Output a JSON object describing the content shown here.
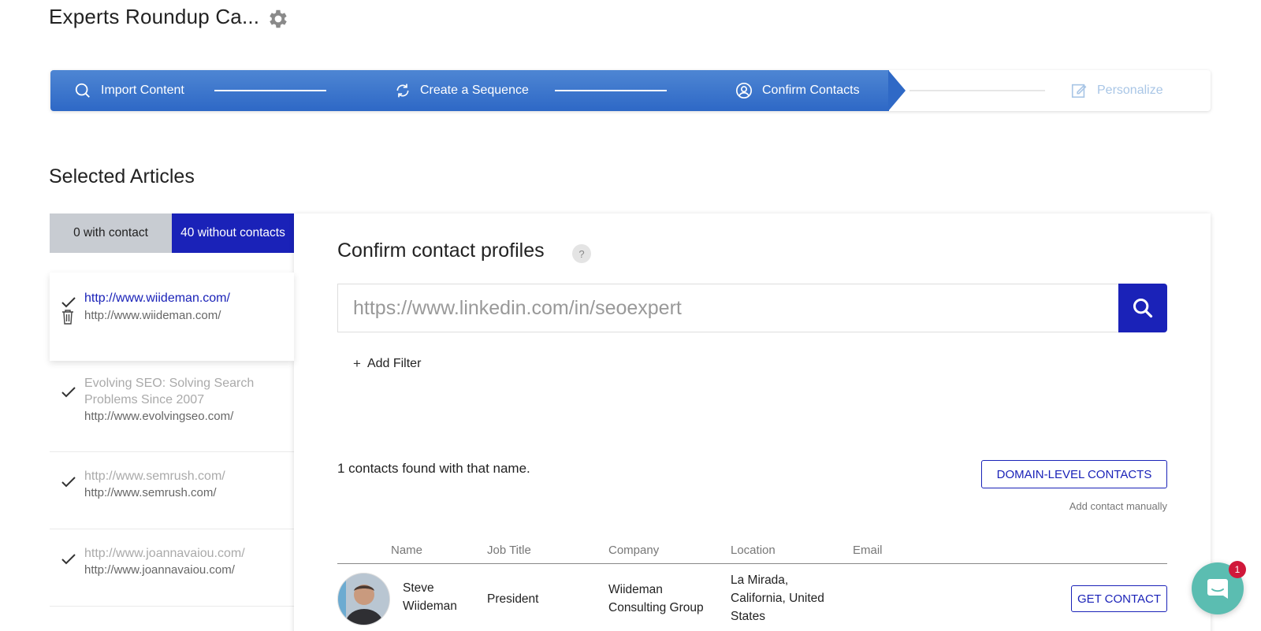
{
  "header": {
    "title": "Experts Roundup Ca...",
    "settings_icon": "gear-icon"
  },
  "stepper": {
    "steps": [
      {
        "label": "Import Content",
        "icon": "search-icon",
        "state": "complete"
      },
      {
        "label": "Create a Sequence",
        "icon": "refresh-icon",
        "state": "complete"
      },
      {
        "label": "Confirm Contacts",
        "icon": "user-circle-icon",
        "state": "current"
      },
      {
        "label": "Personalize",
        "icon": "edit-icon",
        "state": "upcoming"
      }
    ],
    "colors": {
      "active": "#2e68c6",
      "upcoming": "#a9c6e6"
    }
  },
  "section_title": "Selected Articles",
  "filter_tabs": {
    "with_contact": "0 with contact",
    "without_contacts": "40 without contacts"
  },
  "articles": [
    {
      "title": "http://www.wiideman.com/",
      "url": "http://www.wiideman.com/"
    },
    {
      "title": "Evolving SEO: Solving Search Problems Since 2007",
      "url": "http://www.evolvingseo.com/"
    },
    {
      "title": "http://www.semrush.com/",
      "url": "http://www.semrush.com/"
    },
    {
      "title": "http://www.joannavaiou.com/",
      "url": "http://www.joannavaiou.com/"
    }
  ],
  "confirm": {
    "title": "Confirm contact profiles",
    "help": "?",
    "search_placeholder": "https://www.linkedin.com/in/seoexpert",
    "add_filter": "Add Filter",
    "found_text": "1 contacts found with that name.",
    "domain_button": "DOMAIN-LEVEL CONTACTS",
    "add_manual": "Add contact manually",
    "columns": [
      "Name",
      "Job Title",
      "Company",
      "Location",
      "Email"
    ],
    "contacts": [
      {
        "name": "Steve Wiideman",
        "job_title": "President",
        "company": "Wiideman Consulting Group",
        "location": "La Mirada, California, United States",
        "email": "",
        "action": "GET CONTACT"
      }
    ]
  },
  "chat": {
    "badge": "1",
    "icon": "chat-icon",
    "color": "#5bbdb1"
  },
  "brand_color": "#1a22b8"
}
